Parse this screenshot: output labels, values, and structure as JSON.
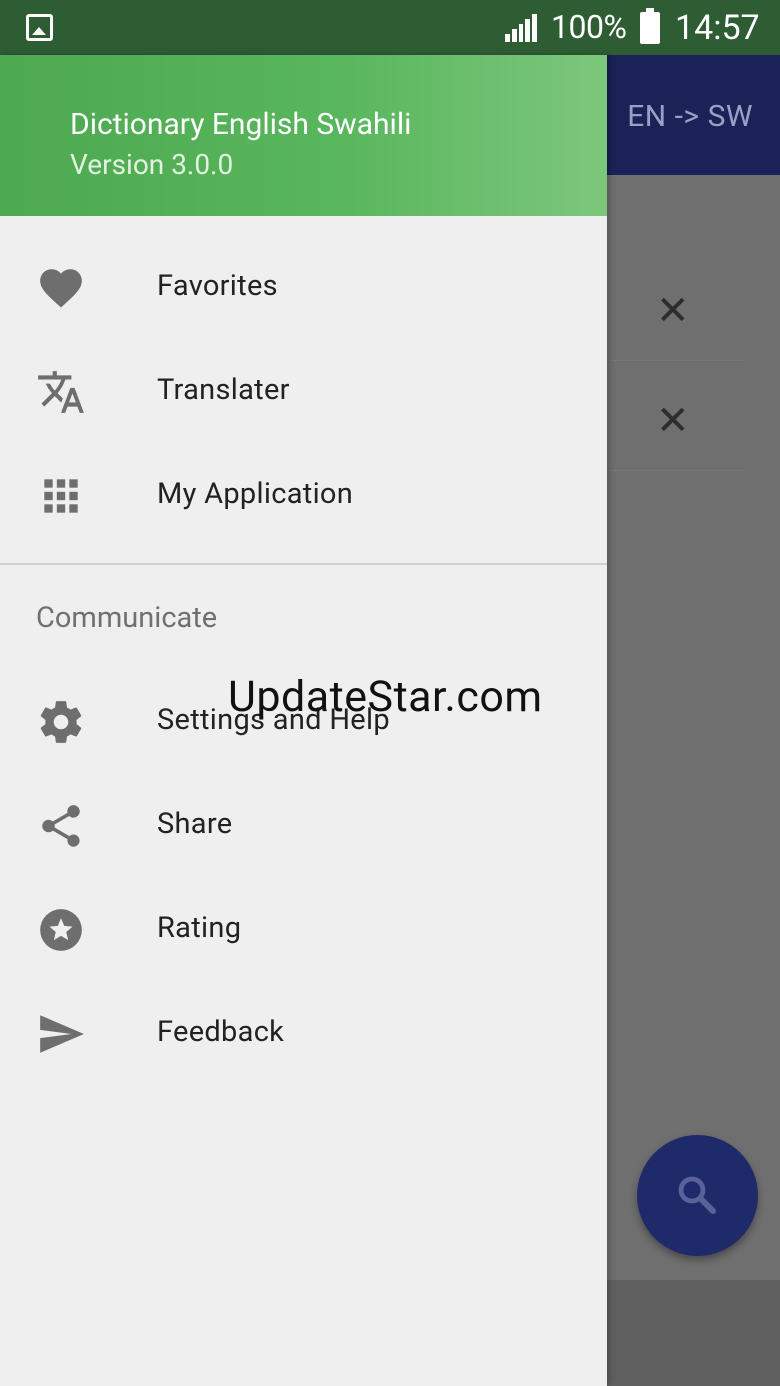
{
  "status_bar": {
    "battery_percent": "100%",
    "time": "14:57"
  },
  "app_bar": {
    "language_pair": "EN -> SW"
  },
  "drawer": {
    "app_name": "Dictionary English Swahili",
    "version": "Version 3.0.0",
    "main_items": [
      {
        "label": "Favorites",
        "icon": "heart-icon"
      },
      {
        "label": "Translater",
        "icon": "translate-icon"
      },
      {
        "label": "My Application",
        "icon": "apps-grid-icon"
      }
    ],
    "section_title": "Communicate",
    "communicate_items": [
      {
        "label": "Settings and Help",
        "icon": "gear-icon"
      },
      {
        "label": "Share",
        "icon": "share-icon"
      },
      {
        "label": "Rating",
        "icon": "star-icon"
      },
      {
        "label": "Feedback",
        "icon": "send-icon"
      }
    ]
  },
  "background_list": {
    "clear_glyph": "✕"
  },
  "watermark": "UpdateStar.com",
  "colors": {
    "header_green": "#4ea950",
    "app_bar_navy": "#1a2257",
    "fab_navy": "#1f2a6b",
    "icon_gray": "#6e6e6e",
    "drawer_bg": "#efefef"
  }
}
